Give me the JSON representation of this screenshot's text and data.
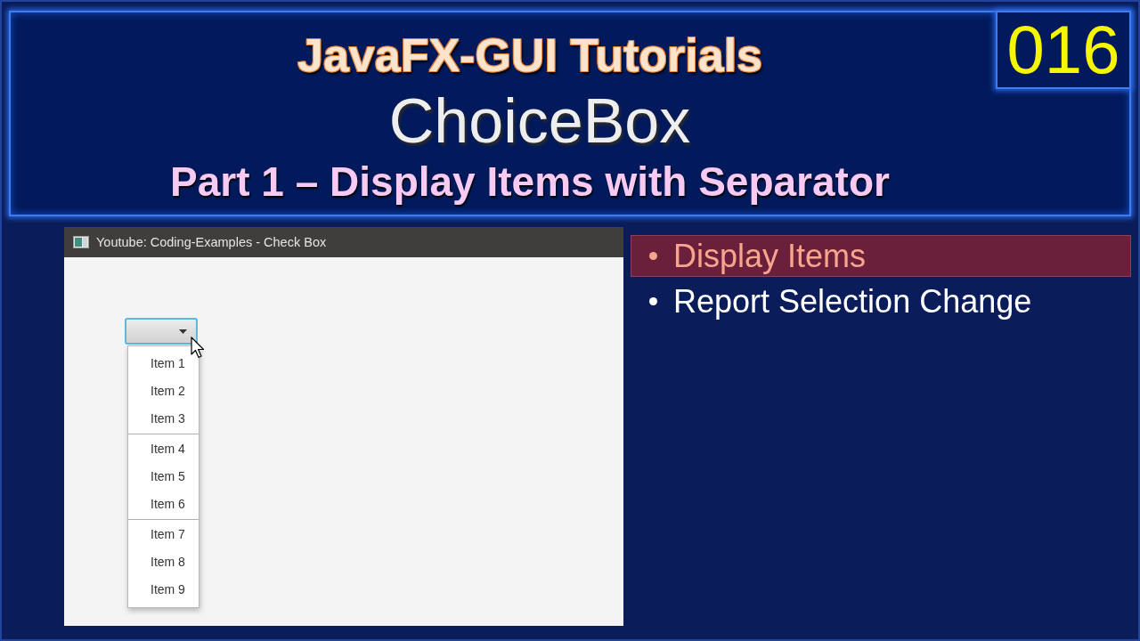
{
  "banner": {
    "series_title": "JavaFX-GUI Tutorials",
    "topic": "ChoiceBox",
    "subtitle": "Part 1 – Display Items with Separator",
    "episode": "016"
  },
  "app_window": {
    "title": "Youtube: Coding-Examples - Check Box",
    "choice_box": {
      "expanded": true,
      "groups": [
        {
          "items": [
            "Item 1",
            "Item 2",
            "Item 3"
          ]
        },
        {
          "items": [
            "Item 4",
            "Item 5",
            "Item 6"
          ]
        },
        {
          "items": [
            "Item 7",
            "Item 8",
            "Item 9"
          ]
        }
      ]
    }
  },
  "outline": [
    {
      "label": "Display Items",
      "selected": true
    },
    {
      "label": "Report Selection Change",
      "selected": false
    }
  ]
}
